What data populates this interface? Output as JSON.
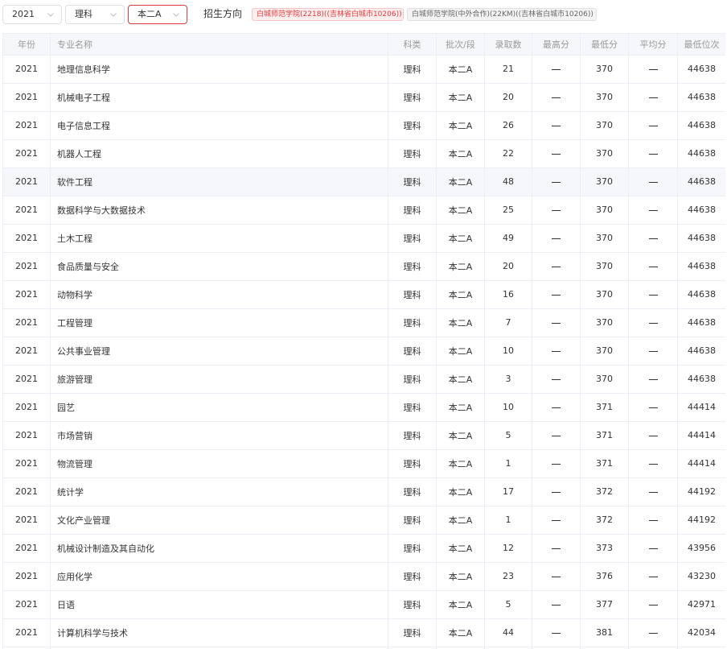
{
  "filters": {
    "year": "2021",
    "subject": "理科",
    "batch": "本二A",
    "direction_label": "招生方向",
    "tags": [
      "白城师范学院(2218)((吉林省白城市10206))",
      "白城师范学院(中外合作)(22KM)((吉林省白城市10206))"
    ]
  },
  "table": {
    "headers": [
      "年份",
      "专业名称",
      "科类",
      "批次/段",
      "录取数",
      "最高分",
      "最低分",
      "平均分",
      "最低位次"
    ],
    "rows": [
      {
        "year": "2021",
        "major": "地理信息科学",
        "subject": "理科",
        "batch": "本二A",
        "admitted": "21",
        "max": "—",
        "min": "370",
        "avg": "—",
        "rank": "44638"
      },
      {
        "year": "2021",
        "major": "机械电子工程",
        "subject": "理科",
        "batch": "本二A",
        "admitted": "20",
        "max": "—",
        "min": "370",
        "avg": "—",
        "rank": "44638"
      },
      {
        "year": "2021",
        "major": "电子信息工程",
        "subject": "理科",
        "batch": "本二A",
        "admitted": "26",
        "max": "—",
        "min": "370",
        "avg": "—",
        "rank": "44638"
      },
      {
        "year": "2021",
        "major": "机器人工程",
        "subject": "理科",
        "batch": "本二A",
        "admitted": "22",
        "max": "—",
        "min": "370",
        "avg": "—",
        "rank": "44638"
      },
      {
        "year": "2021",
        "major": "软件工程",
        "subject": "理科",
        "batch": "本二A",
        "admitted": "48",
        "max": "—",
        "min": "370",
        "avg": "—",
        "rank": "44638"
      },
      {
        "year": "2021",
        "major": "数据科学与大数据技术",
        "subject": "理科",
        "batch": "本二A",
        "admitted": "25",
        "max": "—",
        "min": "370",
        "avg": "—",
        "rank": "44638"
      },
      {
        "year": "2021",
        "major": "土木工程",
        "subject": "理科",
        "batch": "本二A",
        "admitted": "49",
        "max": "—",
        "min": "370",
        "avg": "—",
        "rank": "44638"
      },
      {
        "year": "2021",
        "major": "食品质量与安全",
        "subject": "理科",
        "batch": "本二A",
        "admitted": "20",
        "max": "—",
        "min": "370",
        "avg": "—",
        "rank": "44638"
      },
      {
        "year": "2021",
        "major": "动物科学",
        "subject": "理科",
        "batch": "本二A",
        "admitted": "16",
        "max": "—",
        "min": "370",
        "avg": "—",
        "rank": "44638"
      },
      {
        "year": "2021",
        "major": "工程管理",
        "subject": "理科",
        "batch": "本二A",
        "admitted": "7",
        "max": "—",
        "min": "370",
        "avg": "—",
        "rank": "44638"
      },
      {
        "year": "2021",
        "major": "公共事业管理",
        "subject": "理科",
        "batch": "本二A",
        "admitted": "10",
        "max": "—",
        "min": "370",
        "avg": "—",
        "rank": "44638"
      },
      {
        "year": "2021",
        "major": "旅游管理",
        "subject": "理科",
        "batch": "本二A",
        "admitted": "3",
        "max": "—",
        "min": "370",
        "avg": "—",
        "rank": "44638"
      },
      {
        "year": "2021",
        "major": "园艺",
        "subject": "理科",
        "batch": "本二A",
        "admitted": "10",
        "max": "—",
        "min": "371",
        "avg": "—",
        "rank": "44414"
      },
      {
        "year": "2021",
        "major": "市场营销",
        "subject": "理科",
        "batch": "本二A",
        "admitted": "5",
        "max": "—",
        "min": "371",
        "avg": "—",
        "rank": "44414"
      },
      {
        "year": "2021",
        "major": "物流管理",
        "subject": "理科",
        "batch": "本二A",
        "admitted": "1",
        "max": "—",
        "min": "371",
        "avg": "—",
        "rank": "44414"
      },
      {
        "year": "2021",
        "major": "统计学",
        "subject": "理科",
        "batch": "本二A",
        "admitted": "17",
        "max": "—",
        "min": "372",
        "avg": "—",
        "rank": "44192"
      },
      {
        "year": "2021",
        "major": "文化产业管理",
        "subject": "理科",
        "batch": "本二A",
        "admitted": "1",
        "max": "—",
        "min": "372",
        "avg": "—",
        "rank": "44192"
      },
      {
        "year": "2021",
        "major": "机械设计制造及其自动化",
        "subject": "理科",
        "batch": "本二A",
        "admitted": "12",
        "max": "—",
        "min": "373",
        "avg": "—",
        "rank": "43956"
      },
      {
        "year": "2021",
        "major": "应用化学",
        "subject": "理科",
        "batch": "本二A",
        "admitted": "23",
        "max": "—",
        "min": "376",
        "avg": "—",
        "rank": "43230"
      },
      {
        "year": "2021",
        "major": "日语",
        "subject": "理科",
        "batch": "本二A",
        "admitted": "5",
        "max": "—",
        "min": "377",
        "avg": "—",
        "rank": "42971"
      },
      {
        "year": "2021",
        "major": "计算机科学与技术",
        "subject": "理科",
        "batch": "本二A",
        "admitted": "44",
        "max": "—",
        "min": "381",
        "avg": "—",
        "rank": "42034"
      },
      {
        "year": "2021",
        "major": "",
        "subject": "",
        "batch": "",
        "admitted": "",
        "max": "",
        "min": "",
        "avg": "",
        "rank": ""
      }
    ]
  },
  "colors": {
    "accent": "#e4393c",
    "border": "#ebeef5",
    "header_bg": "#f5f7fa"
  },
  "icons": {
    "dropdown": "chevron-down-icon"
  }
}
